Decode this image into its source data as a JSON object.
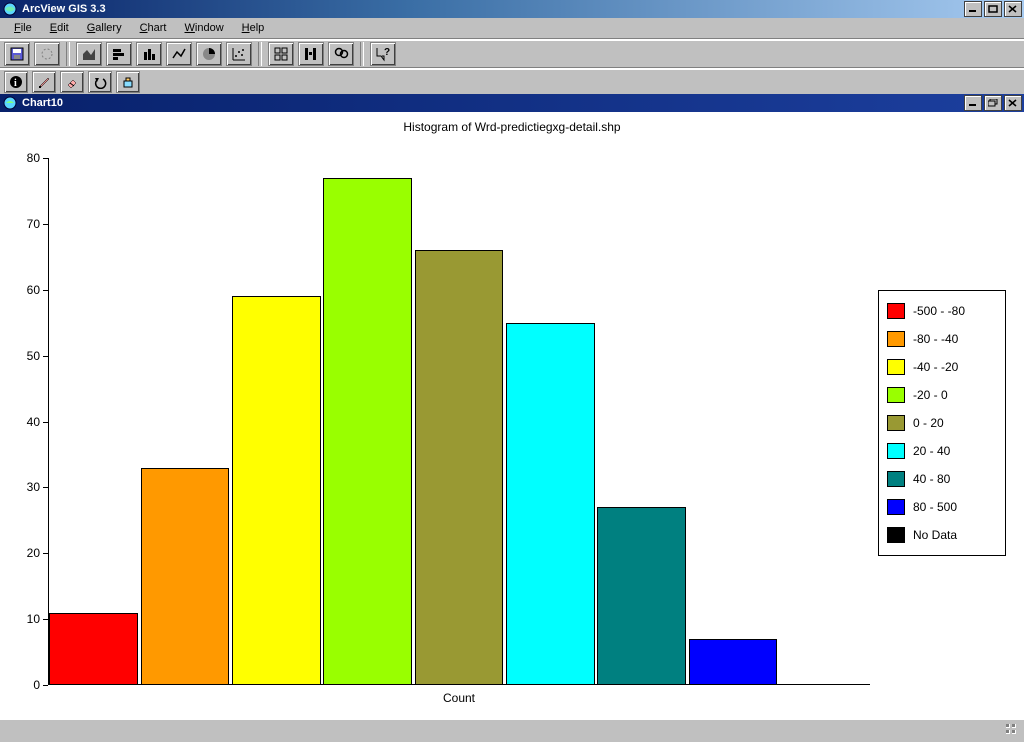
{
  "app": {
    "title": "ArcView GIS 3.3"
  },
  "menus": {
    "file": {
      "label": "File",
      "u": "F",
      "rest": "ile"
    },
    "edit": {
      "label": "Edit",
      "u": "E",
      "rest": "dit"
    },
    "gallery": {
      "label": "Gallery",
      "u": "G",
      "rest": "allery"
    },
    "chart": {
      "label": "Chart",
      "u": "C",
      "rest": "hart"
    },
    "window": {
      "label": "Window",
      "u": "W",
      "rest": "indow"
    },
    "help": {
      "label": "Help",
      "u": "H",
      "rest": "elp"
    }
  },
  "toolbar1": {
    "save": "save-icon",
    "print": "print-icon",
    "area": "area-chart-icon",
    "bar": "bar-chart-icon",
    "column": "column-chart-icon",
    "line": "line-chart-icon",
    "pie": "pie-chart-icon",
    "scatter": "scatter-chart-icon",
    "gallery": "gallery-icon",
    "series": "series-icon",
    "find": "find-icon",
    "help": "context-help-icon"
  },
  "toolbar2": {
    "identify": "info-icon",
    "edit": "edit-point-icon",
    "erase": "erase-icon",
    "undo": "undo-icon",
    "color": "color-icon"
  },
  "mdi": {
    "title": "Chart10"
  },
  "legend": {
    "items": [
      {
        "label": "-500 - -80",
        "color": "#ff0000"
      },
      {
        "label": "-80 - -40",
        "color": "#ff9900"
      },
      {
        "label": "-40 - -20",
        "color": "#ffff00"
      },
      {
        "label": "-20 - 0",
        "color": "#99ff00"
      },
      {
        "label": "0 - 20",
        "color": "#999933"
      },
      {
        "label": "20 - 40",
        "color": "#00ffff"
      },
      {
        "label": "40 - 80",
        "color": "#008080"
      },
      {
        "label": "80 - 500",
        "color": "#0000ff"
      },
      {
        "label": "No Data",
        "color": "#000000"
      }
    ]
  },
  "chart_data": {
    "type": "bar",
    "title": "Histogram of Wrd-predictiegxg-detail.shp",
    "xlabel": "Count",
    "ylabel": "",
    "ylim": [
      0,
      80
    ],
    "yticks": [
      0,
      10,
      20,
      30,
      40,
      50,
      60,
      70,
      80
    ],
    "categories": [
      "-500 - -80",
      "-80 - -40",
      "-40 - -20",
      "-20 - 0",
      "0 - 20",
      "20 - 40",
      "40 - 80",
      "80 - 500",
      "No Data"
    ],
    "values": [
      11,
      33,
      59,
      77,
      66,
      55,
      27,
      7,
      0
    ],
    "colors": [
      "#ff0000",
      "#ff9900",
      "#ffff00",
      "#99ff00",
      "#999933",
      "#00ffff",
      "#008080",
      "#0000ff",
      "#000000"
    ]
  },
  "yticks": {
    "t0": "0",
    "t1": "10",
    "t2": "20",
    "t3": "30",
    "t4": "40",
    "t5": "50",
    "t6": "60",
    "t7": "70",
    "t8": "80"
  }
}
